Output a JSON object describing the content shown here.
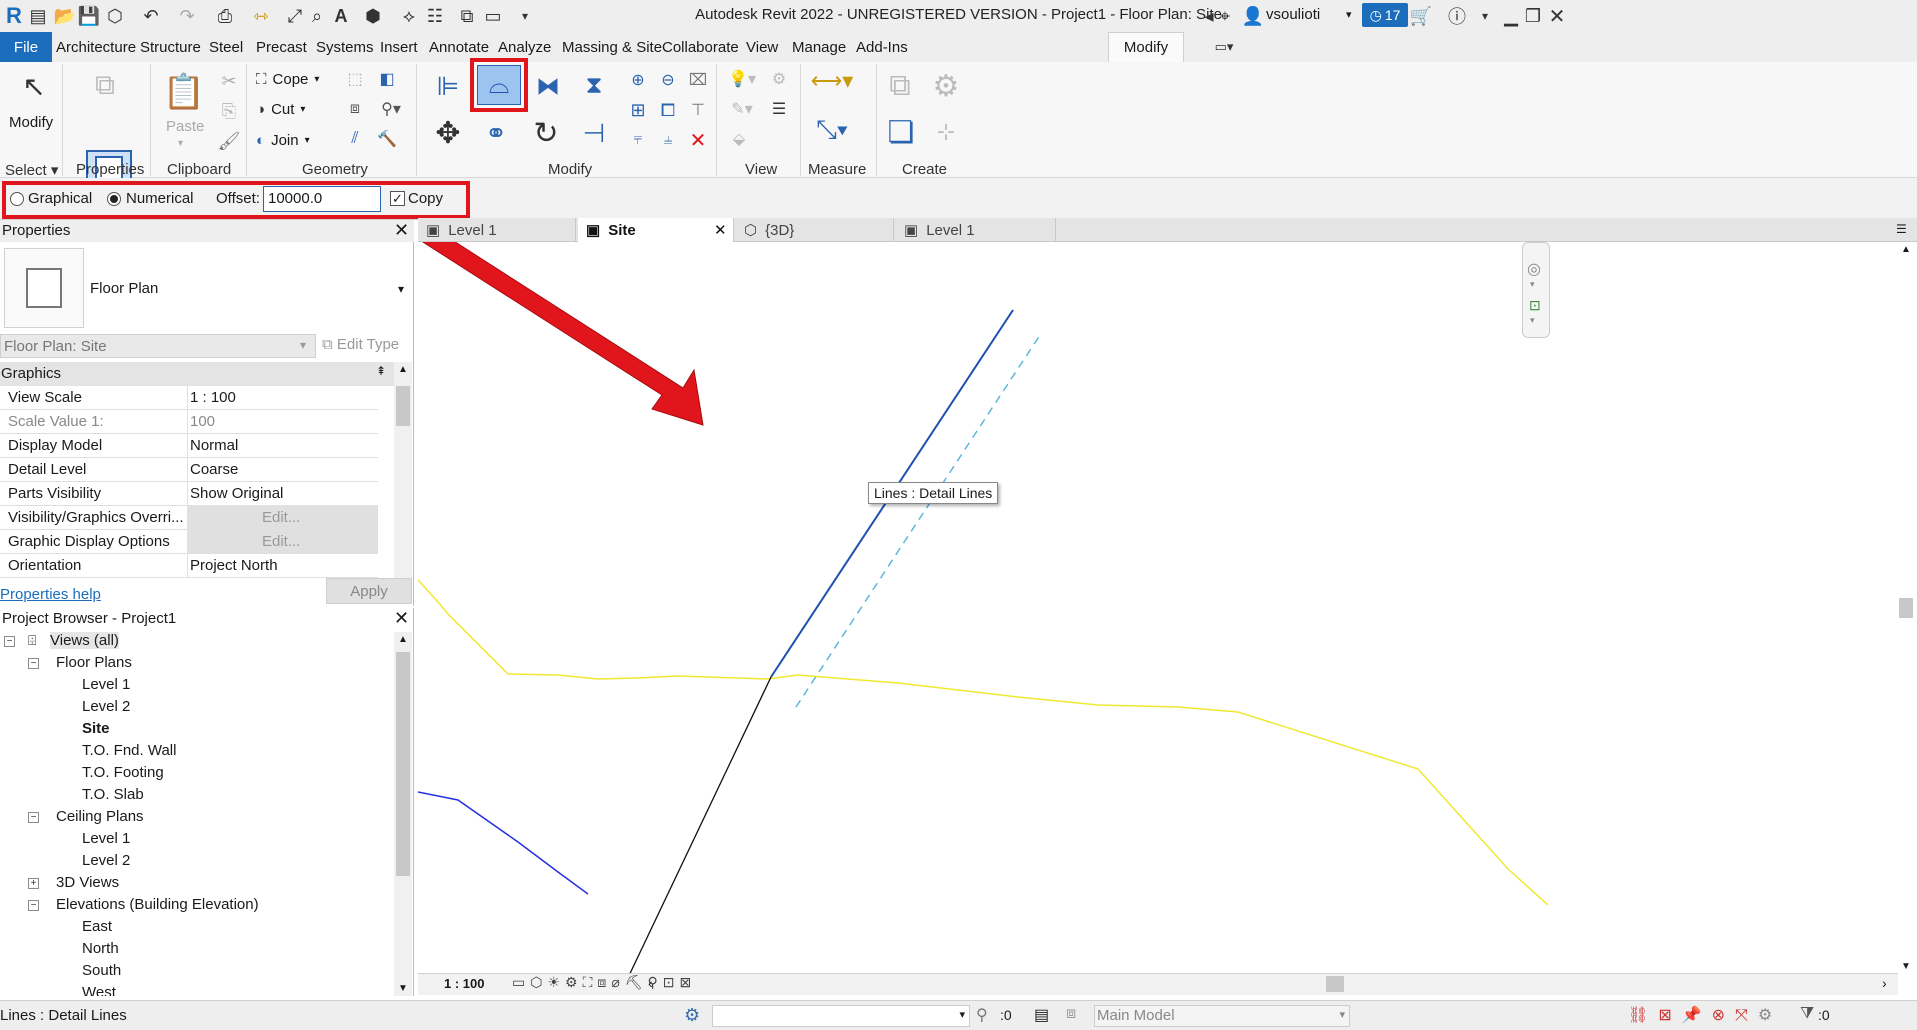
{
  "titlebar": {
    "title": "Autodesk Revit 2022 - UNREGISTERED VERSION - Project1 - Floor Plan: Site",
    "user": "vsoulioti",
    "badge_count": "17"
  },
  "menu": {
    "file": "File",
    "tabs": [
      "Architecture",
      "Structure",
      "Steel",
      "Precast",
      "Systems",
      "Insert",
      "Annotate",
      "Analyze",
      "Massing & Site",
      "Collaborate",
      "View",
      "Manage",
      "Add-Ins",
      "Modify"
    ]
  },
  "ribbon": {
    "modify_label": "Modify",
    "paste_label": "Paste",
    "cope_label": "Cope",
    "cut_label": "Cut",
    "join_label": "Join",
    "panels": {
      "select": "Select",
      "properties": "Properties",
      "clipboard": "Clipboard",
      "geometry": "Geometry",
      "modify": "Modify",
      "view": "View",
      "measure": "Measure",
      "create": "Create"
    },
    "accent_highlight": "#e0161c"
  },
  "options": {
    "graphical_label": "Graphical",
    "numerical_label": "Numerical",
    "offset_label": "Offset:",
    "offset_value": "10000.0",
    "copy_label": "Copy"
  },
  "properties": {
    "title": "Properties",
    "type_name": "Floor Plan",
    "instance_select": "Floor Plan: Site",
    "edit_type": "Edit Type",
    "group": "Graphics",
    "rows": [
      {
        "key": "View Scale",
        "value": "1 : 100"
      },
      {
        "key": "Scale Value    1:",
        "value": "100"
      },
      {
        "key": "Display Model",
        "value": "Normal"
      },
      {
        "key": "Detail Level",
        "value": "Coarse"
      },
      {
        "key": "Parts Visibility",
        "value": "Show Original"
      },
      {
        "key": "Visibility/Graphics Overri...",
        "value": "Edit..."
      },
      {
        "key": "Graphic Display Options",
        "value": "Edit..."
      },
      {
        "key": "Orientation",
        "value": "Project North"
      }
    ],
    "help": "Properties help",
    "apply": "Apply"
  },
  "browser": {
    "title": "Project Browser - Project1",
    "items": [
      {
        "label": "Views (all)",
        "level": 0
      },
      {
        "label": "Floor Plans",
        "level": 1
      },
      {
        "label": "Level 1",
        "level": 2
      },
      {
        "label": "Level 2",
        "level": 2
      },
      {
        "label": "Site",
        "level": 2
      },
      {
        "label": "T.O. Fnd. Wall",
        "level": 2
      },
      {
        "label": "T.O. Footing",
        "level": 2
      },
      {
        "label": "T.O. Slab",
        "level": 2
      },
      {
        "label": "Ceiling Plans",
        "level": 1
      },
      {
        "label": "Level 1",
        "level": 2
      },
      {
        "label": "Level 2",
        "level": 2
      },
      {
        "label": "3D Views",
        "level": 1
      },
      {
        "label": "Elevations (Building Elevation)",
        "level": 1
      },
      {
        "label": "East",
        "level": 2
      },
      {
        "label": "North",
        "level": 2
      },
      {
        "label": "South",
        "level": 2
      },
      {
        "label": "West",
        "level": 2
      }
    ]
  },
  "view_tabs": [
    "Level 1",
    "Site",
    "{3D}",
    "Level 1"
  ],
  "canvas": {
    "tooltip": "Lines : Detail Lines",
    "colors": {
      "selected_line": "#1f4fb0",
      "preview_line": "#5bb8dd",
      "yellow": "#f0e830",
      "black": "#111111",
      "blue": "#2530e0",
      "arrow": "#e0161c"
    }
  },
  "viewbar": {
    "scale": "1 : 100"
  },
  "status": {
    "left": "Lines : Detail Lines",
    "zero1": ":0",
    "workset": "Main Model",
    "filter_count": ":0"
  }
}
